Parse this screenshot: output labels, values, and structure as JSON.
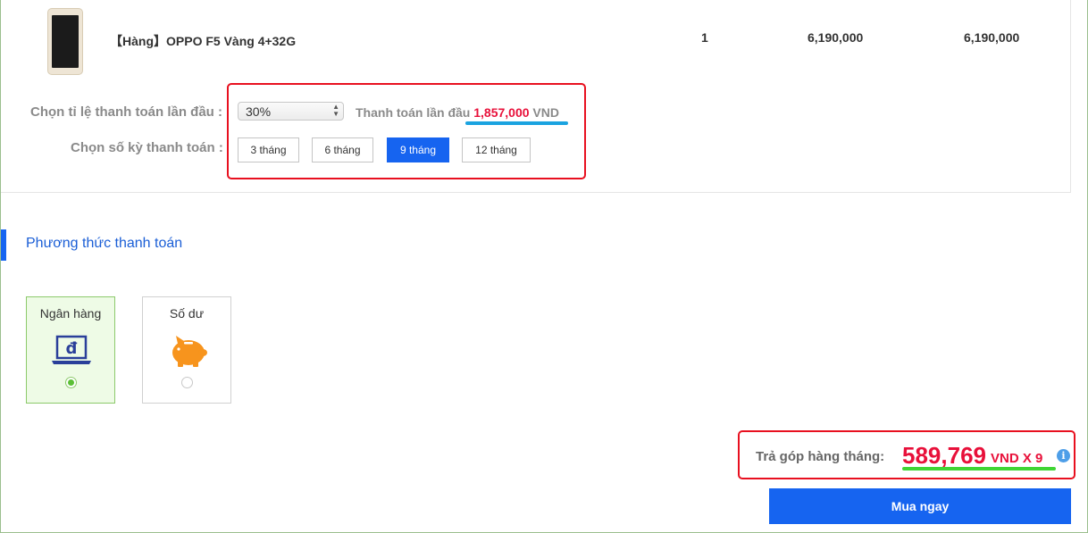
{
  "product": {
    "name": "【Hàng】OPPO F5 Vàng 4+32G",
    "quantity": "1",
    "unit_price": "6,190,000",
    "total_price": "6,190,000"
  },
  "installment": {
    "ratio_label": "Chọn tỉ lệ thanh toán lần đầu :",
    "ratio_selected": "30%",
    "first_payment_label": "Thanh toán lần đầu",
    "first_payment_amount": "1,857,000",
    "first_payment_currency": "VND",
    "term_label": "Chọn số kỳ thanh toán :",
    "terms": [
      "3 tháng",
      "6 tháng",
      "9 tháng",
      "12 tháng"
    ],
    "selected_term": "9 tháng"
  },
  "payment_method": {
    "section_title": "Phương thức thanh toán",
    "options": [
      {
        "label": "Ngân hàng",
        "icon": "bank-laptop-icon",
        "selected": true
      },
      {
        "label": "Số dư",
        "icon": "piggy-bank-icon",
        "selected": false
      }
    ]
  },
  "summary": {
    "monthly_label": "Trả góp hàng tháng:",
    "monthly_amount": "589,769",
    "monthly_suffix": "VND X 9",
    "info_icon": "info-icon"
  },
  "buy_button_label": "Mua ngay",
  "colors": {
    "accent_blue": "#1664f0",
    "price_red": "#e8103a",
    "highlight_red": "#e8101f",
    "highlight_blue": "#1aa3e0",
    "highlight_green": "#3fd534",
    "bank_icon_blue": "#2a3f9a",
    "piggy_orange": "#f7941d",
    "selected_green": "#5bbf36"
  }
}
